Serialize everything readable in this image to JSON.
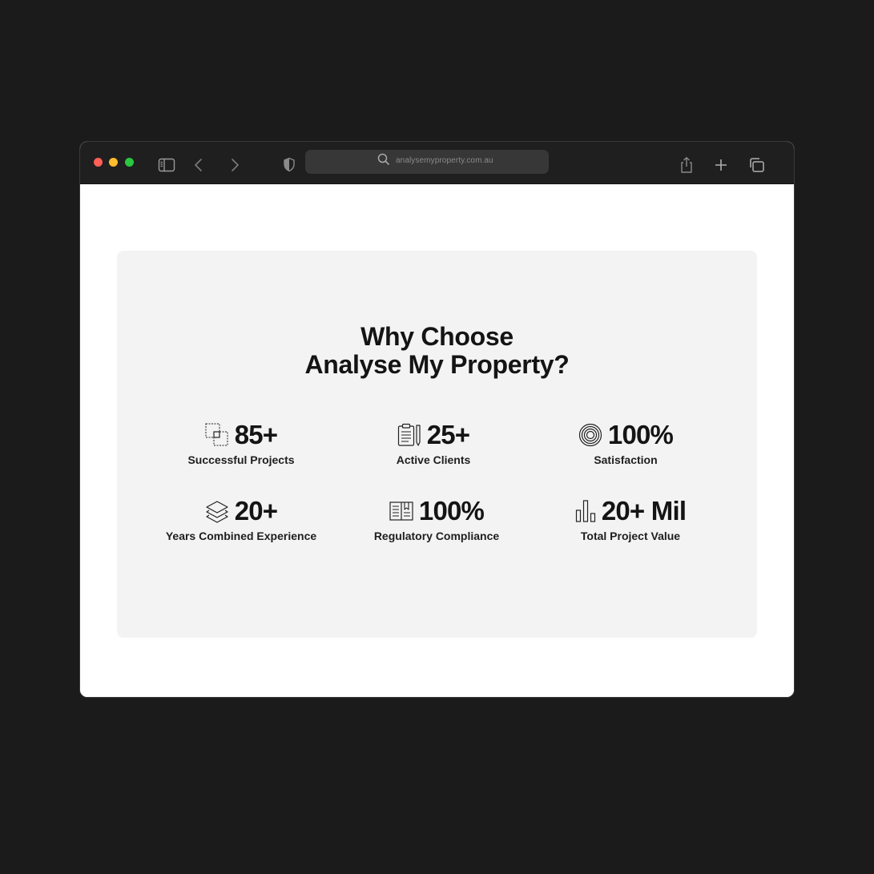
{
  "browser": {
    "url": "analysemyproperty.com.au",
    "icons": [
      "sidebar-icon",
      "back-icon",
      "forward-icon",
      "shield-icon",
      "search-icon",
      "share-icon",
      "new-tab-icon",
      "tabs-overview-icon"
    ]
  },
  "section": {
    "heading_line1": "Why Choose",
    "heading_line2": "Analyse My Property?"
  },
  "stats": [
    {
      "value": "85+",
      "label": "Successful Projects",
      "icon": "overlapping-squares-icon"
    },
    {
      "value": "25+",
      "label": "Active Clients",
      "icon": "clipboard-pen-icon"
    },
    {
      "value": "100%",
      "label": "Satisfaction",
      "icon": "target-icon"
    },
    {
      "value": "20+",
      "label": "Years Combined Experience",
      "icon": "layers-icon"
    },
    {
      "value": "100%",
      "label": "Regulatory Compliance",
      "icon": "open-book-icon"
    },
    {
      "value": "20+ Mil",
      "label": "Total Project Value",
      "icon": "bar-chart-icon"
    }
  ],
  "colors": {
    "page_background": "#1b1b1b",
    "toolbar": "#1f1f1f",
    "card": "#f3f3f3",
    "text": "#141414"
  }
}
